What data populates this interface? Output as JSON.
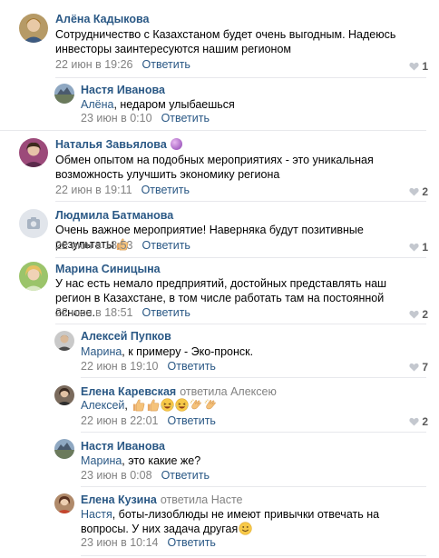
{
  "reply_label": "Ответить",
  "comments": [
    {
      "author": "Алёна Кадыкова",
      "text": "Сотрудничество с Казахстаном будет очень выгодным. Надеюсь инвесторы заинтересуются нашим регионом",
      "date": "22 июн в 19:26",
      "likes": "1"
    },
    {
      "author": "Настя Иванова",
      "mention": "Алёна",
      "text": ", недаром улыбаешься",
      "date": "23 июн в 0:10",
      "likes": ""
    },
    {
      "author": "Наталья Завьялова",
      "text": "Обмен опытом на подобных мероприятиях - это уникальная возможность улучшить экономику региона",
      "date": "22 июн в 19:11",
      "likes": "2"
    },
    {
      "author": "Людмила Батманова",
      "text": "Очень важное мероприятие! Наверняка будут позитивные результаты",
      "date": "22 июн в 18:53",
      "likes": "1"
    },
    {
      "author": "Марина Синицына",
      "text": "У нас есть немало предприятий, достойных представлять наш регион в Казахстане, в том числе работать там на постоянной основе.",
      "date": "22 июн в 18:51",
      "likes": "2"
    },
    {
      "author": "Алексей Пупков",
      "mention": "Марина",
      "text": ", к примеру - Эко-пронск.",
      "date": "22 июн в 19:10",
      "likes": "7"
    },
    {
      "author": "Елена Каревская",
      "reply_to": "ответила Алексею",
      "mention": "Алексей",
      "text": ",",
      "date": "22 июн в 22:01",
      "likes": "2"
    },
    {
      "author": "Настя Иванова",
      "mention": "Марина",
      "text": ", это какие же?",
      "date": "23 июн в 0:08",
      "likes": ""
    },
    {
      "author": "Елена Кузина",
      "reply_to": "ответила Насте",
      "mention": "Настя",
      "text": ", боты-лизоблюды не имеют привычки отвечать на вопросы. У них задача другая",
      "date": "23 июн в 10:14",
      "likes": ""
    }
  ],
  "icons": {
    "like": "heart-icon",
    "thumbs_up": "thumbs-up-emoji",
    "laughing": "laughing-emoji",
    "clapping": "clapping-emoji",
    "smile": "smile-emoji",
    "crystal_ball": "crystal-ball-emoji",
    "camera_placeholder": "camera-icon"
  },
  "colors": {
    "link": "#2a5885",
    "meta": "#828282",
    "divider": "#e7e8ec"
  }
}
